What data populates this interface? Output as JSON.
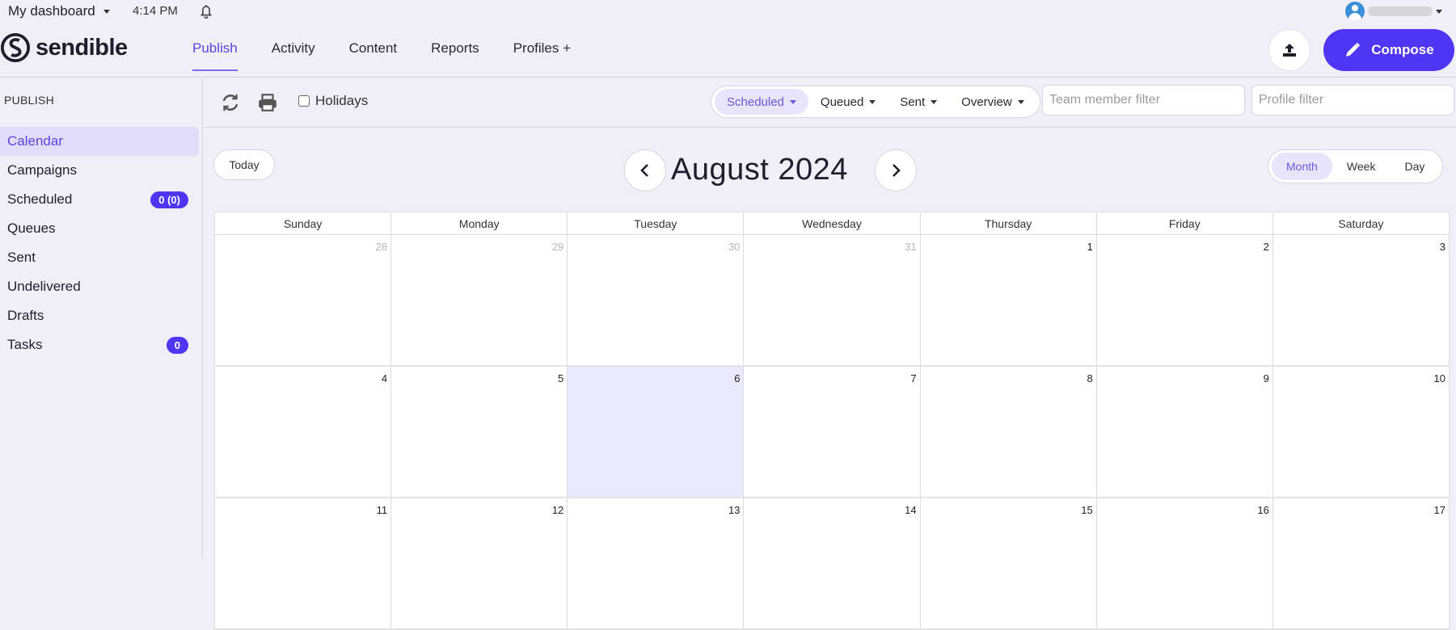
{
  "topbar": {
    "dashboard_label": "My dashboard",
    "time": "4:14 PM"
  },
  "brand": {
    "name": "sendible"
  },
  "nav": {
    "items": [
      {
        "label": "Publish",
        "active": true
      },
      {
        "label": "Activity"
      },
      {
        "label": "Content"
      },
      {
        "label": "Reports"
      },
      {
        "label": "Profiles +"
      }
    ],
    "compose_label": "Compose"
  },
  "sidebar": {
    "heading": "PUBLISH",
    "items": [
      {
        "label": "Calendar",
        "active": true
      },
      {
        "label": "Campaigns"
      },
      {
        "label": "Scheduled",
        "badge": "0 (0)"
      },
      {
        "label": "Queues"
      },
      {
        "label": "Sent"
      },
      {
        "label": "Undelivered"
      },
      {
        "label": "Drafts"
      },
      {
        "label": "Tasks",
        "badge": "0"
      }
    ]
  },
  "toolbar": {
    "holidays_label": "Holidays",
    "holidays_checked": false,
    "filters": [
      {
        "label": "Scheduled",
        "active": true
      },
      {
        "label": "Queued"
      },
      {
        "label": "Sent"
      },
      {
        "label": "Overview"
      }
    ],
    "team_filter_placeholder": "Team member filter",
    "profile_filter_placeholder": "Profile filter"
  },
  "calendar": {
    "today_label": "Today",
    "title": "August 2024",
    "views": [
      {
        "label": "Month",
        "active": true
      },
      {
        "label": "Week"
      },
      {
        "label": "Day"
      }
    ],
    "weekdays": [
      "Sunday",
      "Monday",
      "Tuesday",
      "Wednesday",
      "Thursday",
      "Friday",
      "Saturday"
    ],
    "weeks": [
      [
        {
          "n": "28",
          "other": true
        },
        {
          "n": "29",
          "other": true
        },
        {
          "n": "30",
          "other": true
        },
        {
          "n": "31",
          "other": true
        },
        {
          "n": "1"
        },
        {
          "n": "2"
        },
        {
          "n": "3"
        }
      ],
      [
        {
          "n": "4"
        },
        {
          "n": "5"
        },
        {
          "n": "6",
          "today": true
        },
        {
          "n": "7"
        },
        {
          "n": "8"
        },
        {
          "n": "9"
        },
        {
          "n": "10"
        }
      ],
      [
        {
          "n": "11"
        },
        {
          "n": "12"
        },
        {
          "n": "13"
        },
        {
          "n": "14"
        },
        {
          "n": "15"
        },
        {
          "n": "16"
        },
        {
          "n": "17"
        }
      ]
    ],
    "colors": {
      "accent": "#4f36f5",
      "today_bg": "#eae8fb",
      "active_text": "#5b45e0"
    }
  }
}
